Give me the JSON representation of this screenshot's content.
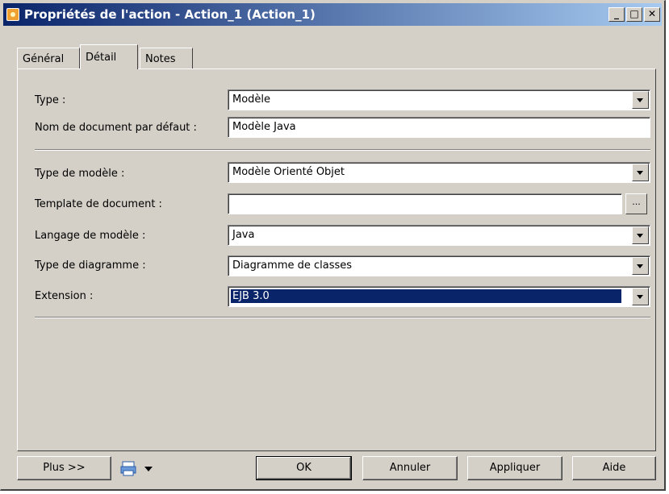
{
  "window": {
    "title": "Propriétés de l'action - Action_1 (Action_1)"
  },
  "titlebar_buttons": [
    "minimize-icon",
    "maximize-icon",
    "close-icon"
  ],
  "tabs": [
    {
      "label": "Général",
      "active": false
    },
    {
      "label": "Détail",
      "active": true
    },
    {
      "label": "Notes",
      "active": false
    }
  ],
  "form": {
    "type": {
      "label": "Type :",
      "value": "Modèle"
    },
    "doc_name": {
      "label": "Nom de document par défaut :",
      "value": "Modèle Java"
    },
    "model_type": {
      "label": "Type de modèle :",
      "value": "Modèle Orienté Objet"
    },
    "doc_template": {
      "label": "Template de document :",
      "value": "",
      "browse_label": "..."
    },
    "model_language": {
      "label": "Langage de modèle :",
      "value": "Java"
    },
    "diagram_type": {
      "label": "Type de diagramme :",
      "value": "Diagramme de classes"
    },
    "extension": {
      "label": "Extension :",
      "value": "EJB 3.0"
    }
  },
  "footer": {
    "more_label": "Plus >>",
    "ok_label": "OK",
    "cancel_label": "Annuler",
    "apply_label": "Appliquer",
    "help_label": "Aide"
  },
  "colors": {
    "title_start": "#0a246a",
    "title_end": "#a6caf0",
    "face": "#d4d0c8",
    "selection": "#0a246a"
  }
}
